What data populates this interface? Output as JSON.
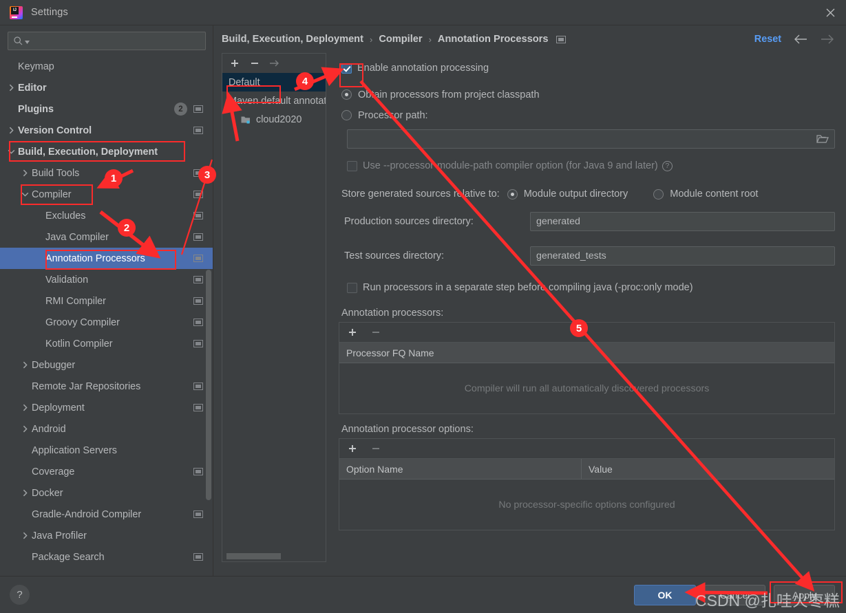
{
  "window": {
    "title": "Settings",
    "logo_icon": "intellij-idea-logo",
    "close_icon": "close-icon"
  },
  "sidebar": {
    "search": {
      "placeholder": "",
      "value": "",
      "icon": "search-icon",
      "dropdown_icon": "chevron-down-icon"
    },
    "items": [
      {
        "label": "Keymap",
        "indent": 0,
        "twisty": "none",
        "bold": false,
        "chip": false
      },
      {
        "label": "Editor",
        "indent": 0,
        "twisty": "collapsed",
        "bold": true,
        "chip": false
      },
      {
        "label": "Plugins",
        "indent": 0,
        "twisty": "none",
        "bold": true,
        "chip": true,
        "badge": "2"
      },
      {
        "label": "Version Control",
        "indent": 0,
        "twisty": "collapsed",
        "bold": true,
        "chip": true
      },
      {
        "label": "Build, Execution, Deployment",
        "indent": 0,
        "twisty": "expanded",
        "bold": true,
        "chip": false
      },
      {
        "label": "Build Tools",
        "indent": 1,
        "twisty": "collapsed",
        "bold": false,
        "chip": true
      },
      {
        "label": "Compiler",
        "indent": 1,
        "twisty": "expanded",
        "bold": false,
        "chip": true
      },
      {
        "label": "Excludes",
        "indent": 2,
        "twisty": "none",
        "bold": false,
        "chip": true
      },
      {
        "label": "Java Compiler",
        "indent": 2,
        "twisty": "none",
        "bold": false,
        "chip": true
      },
      {
        "label": "Annotation Processors",
        "indent": 2,
        "twisty": "none",
        "bold": false,
        "chip": true,
        "selected": true
      },
      {
        "label": "Validation",
        "indent": 2,
        "twisty": "none",
        "bold": false,
        "chip": true
      },
      {
        "label": "RMI Compiler",
        "indent": 2,
        "twisty": "none",
        "bold": false,
        "chip": true
      },
      {
        "label": "Groovy Compiler",
        "indent": 2,
        "twisty": "none",
        "bold": false,
        "chip": true
      },
      {
        "label": "Kotlin Compiler",
        "indent": 2,
        "twisty": "none",
        "bold": false,
        "chip": true
      },
      {
        "label": "Debugger",
        "indent": 1,
        "twisty": "collapsed",
        "bold": false,
        "chip": false
      },
      {
        "label": "Remote Jar Repositories",
        "indent": 1,
        "twisty": "none",
        "bold": false,
        "chip": true
      },
      {
        "label": "Deployment",
        "indent": 1,
        "twisty": "collapsed",
        "bold": false,
        "chip": true
      },
      {
        "label": "Android",
        "indent": 1,
        "twisty": "collapsed",
        "bold": false,
        "chip": false
      },
      {
        "label": "Application Servers",
        "indent": 1,
        "twisty": "none",
        "bold": false,
        "chip": false
      },
      {
        "label": "Coverage",
        "indent": 1,
        "twisty": "none",
        "bold": false,
        "chip": true
      },
      {
        "label": "Docker",
        "indent": 1,
        "twisty": "collapsed",
        "bold": false,
        "chip": false
      },
      {
        "label": "Gradle-Android Compiler",
        "indent": 1,
        "twisty": "none",
        "bold": false,
        "chip": true
      },
      {
        "label": "Java Profiler",
        "indent": 1,
        "twisty": "collapsed",
        "bold": false,
        "chip": false
      },
      {
        "label": "Package Search",
        "indent": 1,
        "twisty": "none",
        "bold": false,
        "chip": true
      }
    ]
  },
  "breadcrumb": {
    "parts": [
      "Build, Execution, Deployment",
      "Compiler",
      "Annotation Processors"
    ],
    "separator": "›",
    "chip_icon": "project-scope-icon",
    "reset_label": "Reset",
    "back_icon": "arrow-left-icon",
    "forward_icon": "arrow-right-icon"
  },
  "profiles": {
    "toolbar": {
      "add_icon": "plus-icon",
      "remove_icon": "minus-icon",
      "move_icon": "arrow-right-icon"
    },
    "rows": [
      {
        "label": "Default",
        "selected": true,
        "child": false
      },
      {
        "label": "Maven default annotation",
        "selected": false,
        "child": false
      },
      {
        "label": "cloud2020",
        "selected": false,
        "child": true,
        "icon": "module-folder-icon"
      }
    ]
  },
  "settings": {
    "enable_annotation_processing": {
      "label": "Enable annotation processing",
      "checked": true
    },
    "source_mode": {
      "obtain_from_classpath": {
        "label": "Obtain processors from project classpath",
        "selected": true
      },
      "processor_path": {
        "label": "Processor path:",
        "selected": false,
        "value": "",
        "browse_icon": "folder-icon"
      }
    },
    "module_path_option": {
      "label": "Use --processor-module-path compiler option (for Java 9 and later)",
      "checked": false,
      "help_icon": "help-circle-icon",
      "help_glyph": "?"
    },
    "store_relative": {
      "label": "Store generated sources relative to:",
      "options": [
        {
          "label": "Module output directory",
          "selected": true
        },
        {
          "label": "Module content root",
          "selected": false
        }
      ]
    },
    "production_sources": {
      "label": "Production sources directory:",
      "value": "generated"
    },
    "test_sources": {
      "label": "Test sources directory:",
      "value": "generated_tests"
    },
    "separate_step": {
      "label": "Run processors in a separate step before compiling java (-proc:only mode)",
      "checked": false
    },
    "processors_table": {
      "title": "Annotation processors:",
      "toolbar": {
        "add_icon": "plus-icon",
        "remove_icon": "minus-icon"
      },
      "columns": [
        "Processor FQ Name"
      ],
      "empty_message": "Compiler will run all automatically discovered processors",
      "rows": []
    },
    "options_table": {
      "title": "Annotation processor options:",
      "toolbar": {
        "add_icon": "plus-icon",
        "remove_icon": "minus-icon"
      },
      "columns": [
        "Option Name",
        "Value"
      ],
      "empty_message": "No processor-specific options configured",
      "rows": []
    }
  },
  "footer": {
    "help_glyph": "?",
    "buttons": [
      {
        "label": "OK",
        "primary": true
      },
      {
        "label": "Cancel",
        "primary": false
      },
      {
        "label": "Apply",
        "primary": false
      }
    ]
  },
  "annotations": {
    "accent_color": "#fb2b2b",
    "markers": [
      {
        "number": "1"
      },
      {
        "number": "2"
      },
      {
        "number": "3"
      },
      {
        "number": "4"
      },
      {
        "number": "5"
      }
    ]
  },
  "watermark": {
    "text": "CSDN @扎哇火枣糕"
  }
}
